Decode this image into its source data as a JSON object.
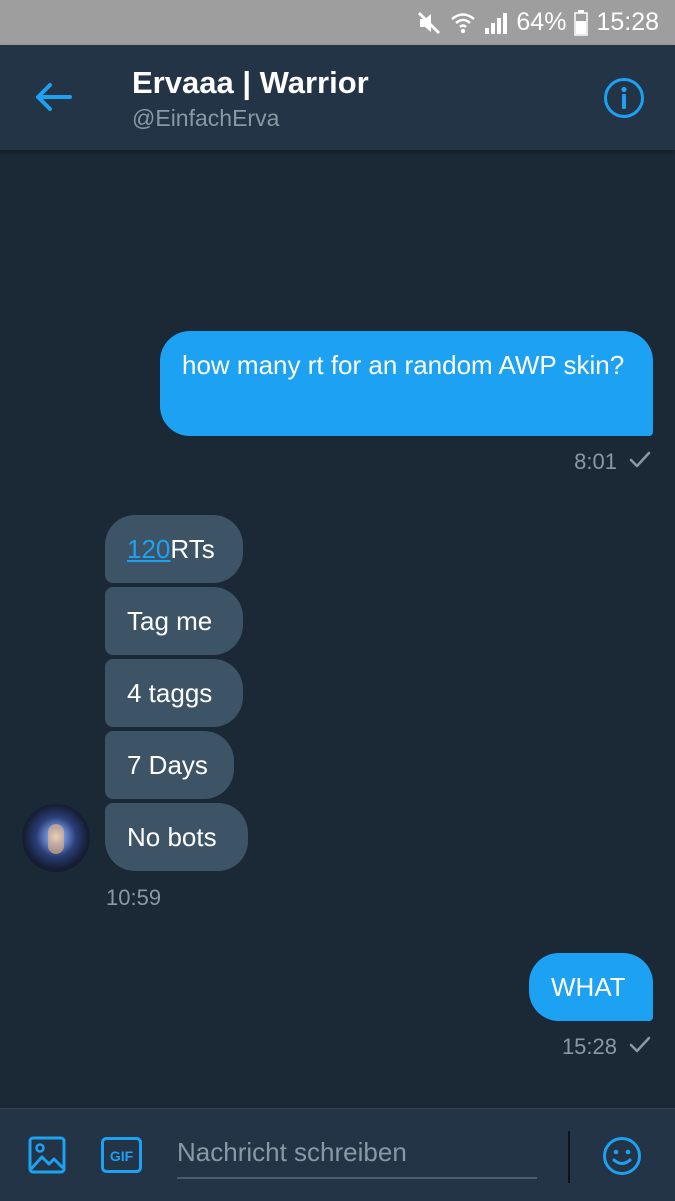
{
  "status_bar": {
    "battery": "64%",
    "time": "15:28"
  },
  "header": {
    "title": "Ervaaa | Warrior",
    "handle": "@EinfachErva"
  },
  "messages": {
    "sent_1": {
      "text": "how many rt for an random AWP skin?",
      "time": "8:01"
    },
    "received": {
      "first_link": "120",
      "first_rest": "RTs",
      "item_2": "Tag me",
      "item_3": "4 taggs",
      "item_4": "7 Days",
      "item_5": "No bots",
      "time": "10:59"
    },
    "sent_2": {
      "text": "WHAT",
      "time": "15:28"
    }
  },
  "composer": {
    "placeholder": "Nachricht schreiben",
    "gif_label": "GIF"
  },
  "colors": {
    "background": "#1b2836",
    "header": "#243447",
    "accent": "#1da1f2",
    "received_bubble": "#3d5466",
    "muted_text": "#8899a6"
  },
  "icons": {
    "mute": "mute-icon",
    "wifi": "wifi-icon",
    "signal": "signal-icon",
    "battery": "battery-icon",
    "back": "back-arrow-icon",
    "info": "info-icon",
    "media": "image-icon",
    "gif": "gif-icon",
    "emoji": "emoji-icon",
    "check": "check-icon"
  }
}
